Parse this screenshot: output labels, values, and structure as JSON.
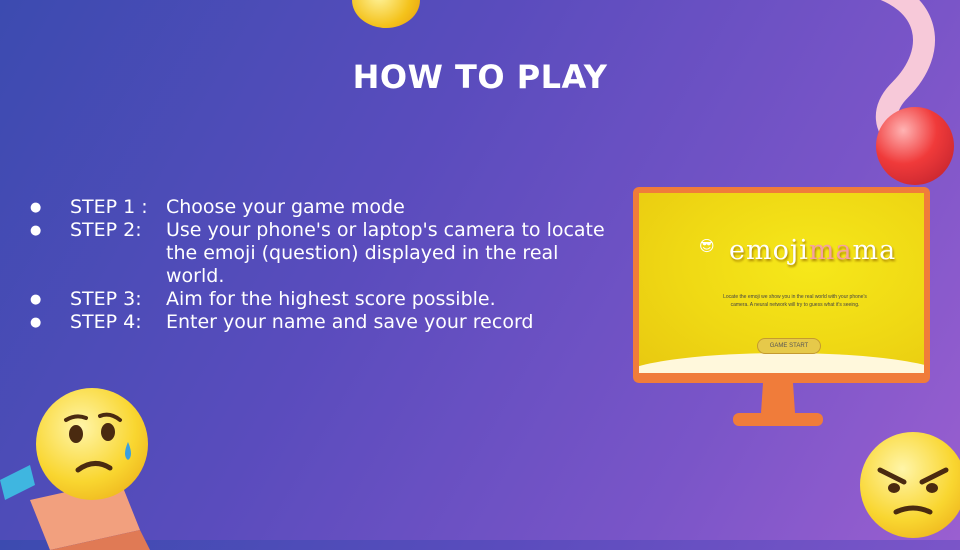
{
  "title": "HOW TO PLAY",
  "steps": [
    {
      "bullet": "●",
      "label": "STEP 1 :",
      "text": "Choose your game mode"
    },
    {
      "bullet": "●",
      "label": "STEP 2:",
      "text": "Use your phone's or laptop's camera to locate the emoji (question) displayed in the real world."
    },
    {
      "bullet": "●",
      "label": "STEP 3:",
      "text": "Aim for the highest score possible."
    },
    {
      "bullet": "●",
      "label": "STEP 4:",
      "text": "Enter your name and save your record"
    }
  ],
  "preview": {
    "logo_left": "emoji",
    "logo_mid": "ma",
    "logo_right": "ma",
    "description": "Locate the emoji we show you in the real world with your phone's camera. A neural network will try to guess what it's seeing.",
    "start_button": "GAME START"
  },
  "colors": {
    "accent": "#f07c3a",
    "screen": "#f6e81a"
  },
  "icons": [
    "sunglasses-emoji-icon",
    "crying-emoji-icon",
    "angry-emoji-icon"
  ]
}
